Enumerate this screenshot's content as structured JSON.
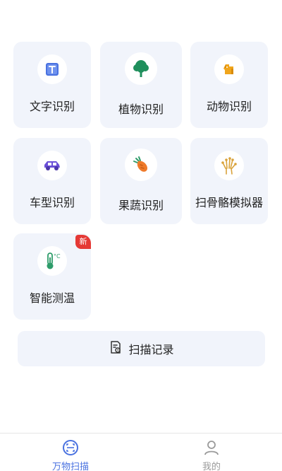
{
  "tools": [
    {
      "label": "文字识别",
      "icon": "text-recognition-icon"
    },
    {
      "label": "植物识别",
      "icon": "tree-icon"
    },
    {
      "label": "动物识别",
      "icon": "dog-icon"
    },
    {
      "label": "车型识别",
      "icon": "car-icon"
    },
    {
      "label": "果蔬识别",
      "icon": "carrot-icon"
    },
    {
      "label": "扫骨骼模拟器",
      "icon": "hand-bone-icon"
    },
    {
      "label": "智能测温",
      "icon": "thermometer-icon",
      "badge": "新"
    }
  ],
  "history_button": {
    "label": "扫描记录",
    "icon": "scan-record-icon"
  },
  "tabbar": {
    "tabs": [
      {
        "label": "万物扫描",
        "icon": "scan-icon",
        "active": true
      },
      {
        "label": "我的",
        "icon": "user-icon",
        "active": false
      }
    ]
  },
  "colors": {
    "accent": "#4a72e0",
    "tile_bg": "#f1f4fb",
    "badge": "#e53935",
    "tree_green": "#1f8f5c",
    "dog_orange": "#f0a51c",
    "car_purple": "#6a4fd8",
    "carrot_orange": "#ef7a2a",
    "thermo_green": "#2e9c6a"
  }
}
